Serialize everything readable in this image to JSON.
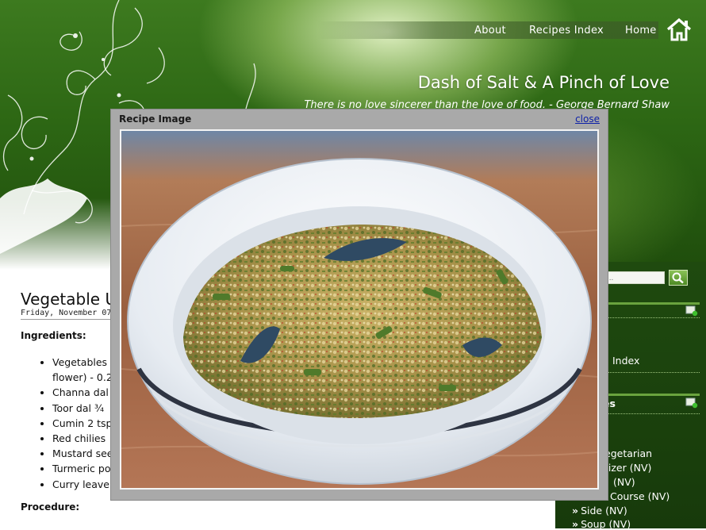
{
  "nav": {
    "items": [
      "About",
      "Recipes Index",
      "Home"
    ]
  },
  "site": {
    "title": "Dash of Salt & A Pinch of Love",
    "tagline": "There is no love sincerer than the love of food. - George Bernard Shaw"
  },
  "post": {
    "title": "Vegetable U",
    "date": "Friday, November 07",
    "ingredients_heading": "Ingredients:",
    "ingredients": [
      "Vegetables",
      "flower) - 0.2",
      "Channa dal",
      "Toor dal ¾",
      "Cumin 2 tsp",
      "Red chilies",
      "Mustard see",
      "Turmeric po",
      "Curry leave"
    ],
    "procedure_heading": "Procedure:"
  },
  "sidebar": {
    "search_placeholder": "...",
    "recipes_index_partial": "Index",
    "labels_heading_partial": "es",
    "labels": [
      "t",
      "egetarian",
      "tizer (NV)",
      "(NV)",
      "Course (NV)",
      "Side (NV)",
      "Soup (NV)"
    ]
  },
  "modal": {
    "title": "Recipe Image",
    "close_label": "close",
    "image_subject": "bowl of vegetable usili"
  },
  "colors": {
    "header_green": "#2d6714",
    "sidebar_green": "#1f4a0f",
    "modal_gray": "#a9a9a9",
    "close_link": "#0b1fa8"
  }
}
